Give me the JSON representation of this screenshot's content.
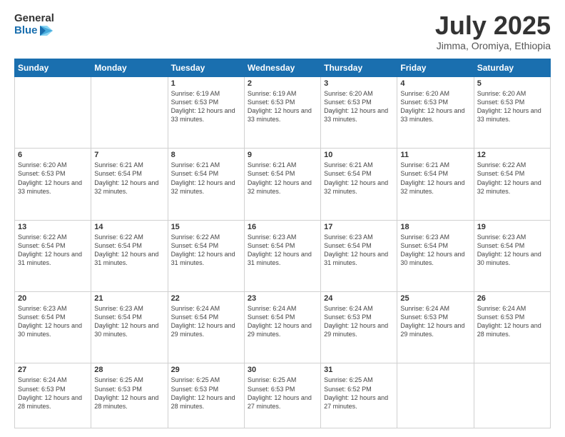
{
  "header": {
    "logo_line1": "General",
    "logo_line2": "Blue",
    "month": "July 2025",
    "location": "Jimma, Oromiya, Ethiopia"
  },
  "weekdays": [
    "Sunday",
    "Monday",
    "Tuesday",
    "Wednesday",
    "Thursday",
    "Friday",
    "Saturday"
  ],
  "weeks": [
    [
      {
        "day": "",
        "sunrise": "",
        "sunset": "",
        "daylight": "",
        "empty": true
      },
      {
        "day": "",
        "sunrise": "",
        "sunset": "",
        "daylight": "",
        "empty": true
      },
      {
        "day": "1",
        "sunrise": "Sunrise: 6:19 AM",
        "sunset": "Sunset: 6:53 PM",
        "daylight": "Daylight: 12 hours and 33 minutes."
      },
      {
        "day": "2",
        "sunrise": "Sunrise: 6:19 AM",
        "sunset": "Sunset: 6:53 PM",
        "daylight": "Daylight: 12 hours and 33 minutes."
      },
      {
        "day": "3",
        "sunrise": "Sunrise: 6:20 AM",
        "sunset": "Sunset: 6:53 PM",
        "daylight": "Daylight: 12 hours and 33 minutes."
      },
      {
        "day": "4",
        "sunrise": "Sunrise: 6:20 AM",
        "sunset": "Sunset: 6:53 PM",
        "daylight": "Daylight: 12 hours and 33 minutes."
      },
      {
        "day": "5",
        "sunrise": "Sunrise: 6:20 AM",
        "sunset": "Sunset: 6:53 PM",
        "daylight": "Daylight: 12 hours and 33 minutes."
      }
    ],
    [
      {
        "day": "6",
        "sunrise": "Sunrise: 6:20 AM",
        "sunset": "Sunset: 6:53 PM",
        "daylight": "Daylight: 12 hours and 33 minutes."
      },
      {
        "day": "7",
        "sunrise": "Sunrise: 6:21 AM",
        "sunset": "Sunset: 6:54 PM",
        "daylight": "Daylight: 12 hours and 32 minutes."
      },
      {
        "day": "8",
        "sunrise": "Sunrise: 6:21 AM",
        "sunset": "Sunset: 6:54 PM",
        "daylight": "Daylight: 12 hours and 32 minutes."
      },
      {
        "day": "9",
        "sunrise": "Sunrise: 6:21 AM",
        "sunset": "Sunset: 6:54 PM",
        "daylight": "Daylight: 12 hours and 32 minutes."
      },
      {
        "day": "10",
        "sunrise": "Sunrise: 6:21 AM",
        "sunset": "Sunset: 6:54 PM",
        "daylight": "Daylight: 12 hours and 32 minutes."
      },
      {
        "day": "11",
        "sunrise": "Sunrise: 6:21 AM",
        "sunset": "Sunset: 6:54 PM",
        "daylight": "Daylight: 12 hours and 32 minutes."
      },
      {
        "day": "12",
        "sunrise": "Sunrise: 6:22 AM",
        "sunset": "Sunset: 6:54 PM",
        "daylight": "Daylight: 12 hours and 32 minutes."
      }
    ],
    [
      {
        "day": "13",
        "sunrise": "Sunrise: 6:22 AM",
        "sunset": "Sunset: 6:54 PM",
        "daylight": "Daylight: 12 hours and 31 minutes."
      },
      {
        "day": "14",
        "sunrise": "Sunrise: 6:22 AM",
        "sunset": "Sunset: 6:54 PM",
        "daylight": "Daylight: 12 hours and 31 minutes."
      },
      {
        "day": "15",
        "sunrise": "Sunrise: 6:22 AM",
        "sunset": "Sunset: 6:54 PM",
        "daylight": "Daylight: 12 hours and 31 minutes."
      },
      {
        "day": "16",
        "sunrise": "Sunrise: 6:23 AM",
        "sunset": "Sunset: 6:54 PM",
        "daylight": "Daylight: 12 hours and 31 minutes."
      },
      {
        "day": "17",
        "sunrise": "Sunrise: 6:23 AM",
        "sunset": "Sunset: 6:54 PM",
        "daylight": "Daylight: 12 hours and 31 minutes."
      },
      {
        "day": "18",
        "sunrise": "Sunrise: 6:23 AM",
        "sunset": "Sunset: 6:54 PM",
        "daylight": "Daylight: 12 hours and 30 minutes."
      },
      {
        "day": "19",
        "sunrise": "Sunrise: 6:23 AM",
        "sunset": "Sunset: 6:54 PM",
        "daylight": "Daylight: 12 hours and 30 minutes."
      }
    ],
    [
      {
        "day": "20",
        "sunrise": "Sunrise: 6:23 AM",
        "sunset": "Sunset: 6:54 PM",
        "daylight": "Daylight: 12 hours and 30 minutes."
      },
      {
        "day": "21",
        "sunrise": "Sunrise: 6:23 AM",
        "sunset": "Sunset: 6:54 PM",
        "daylight": "Daylight: 12 hours and 30 minutes."
      },
      {
        "day": "22",
        "sunrise": "Sunrise: 6:24 AM",
        "sunset": "Sunset: 6:54 PM",
        "daylight": "Daylight: 12 hours and 29 minutes."
      },
      {
        "day": "23",
        "sunrise": "Sunrise: 6:24 AM",
        "sunset": "Sunset: 6:54 PM",
        "daylight": "Daylight: 12 hours and 29 minutes."
      },
      {
        "day": "24",
        "sunrise": "Sunrise: 6:24 AM",
        "sunset": "Sunset: 6:53 PM",
        "daylight": "Daylight: 12 hours and 29 minutes."
      },
      {
        "day": "25",
        "sunrise": "Sunrise: 6:24 AM",
        "sunset": "Sunset: 6:53 PM",
        "daylight": "Daylight: 12 hours and 29 minutes."
      },
      {
        "day": "26",
        "sunrise": "Sunrise: 6:24 AM",
        "sunset": "Sunset: 6:53 PM",
        "daylight": "Daylight: 12 hours and 28 minutes."
      }
    ],
    [
      {
        "day": "27",
        "sunrise": "Sunrise: 6:24 AM",
        "sunset": "Sunset: 6:53 PM",
        "daylight": "Daylight: 12 hours and 28 minutes."
      },
      {
        "day": "28",
        "sunrise": "Sunrise: 6:25 AM",
        "sunset": "Sunset: 6:53 PM",
        "daylight": "Daylight: 12 hours and 28 minutes."
      },
      {
        "day": "29",
        "sunrise": "Sunrise: 6:25 AM",
        "sunset": "Sunset: 6:53 PM",
        "daylight": "Daylight: 12 hours and 28 minutes."
      },
      {
        "day": "30",
        "sunrise": "Sunrise: 6:25 AM",
        "sunset": "Sunset: 6:53 PM",
        "daylight": "Daylight: 12 hours and 27 minutes."
      },
      {
        "day": "31",
        "sunrise": "Sunrise: 6:25 AM",
        "sunset": "Sunset: 6:52 PM",
        "daylight": "Daylight: 12 hours and 27 minutes."
      },
      {
        "day": "",
        "sunrise": "",
        "sunset": "",
        "daylight": "",
        "empty": true
      },
      {
        "day": "",
        "sunrise": "",
        "sunset": "",
        "daylight": "",
        "empty": true
      }
    ]
  ]
}
